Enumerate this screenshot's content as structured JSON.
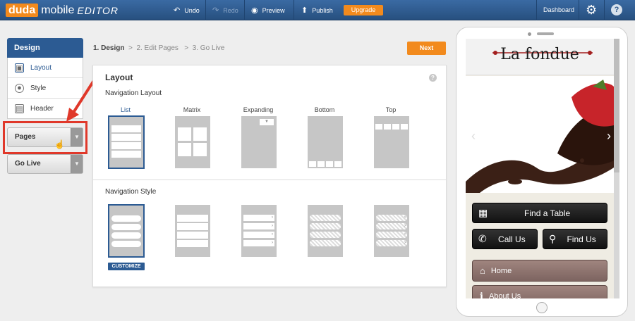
{
  "topbar": {
    "logo_duda": "duda",
    "logo_mobile": "mobile",
    "logo_editor": "EDITOR",
    "undo": "Undo",
    "redo": "Redo",
    "preview": "Preview",
    "publish": "Publish",
    "upgrade": "Upgrade",
    "dashboard": "Dashboard",
    "help": "?"
  },
  "sidebar": {
    "design": "Design",
    "items": [
      {
        "label": "Layout",
        "icon": "layout-icon",
        "active": true
      },
      {
        "label": "Style",
        "icon": "palette-icon",
        "active": false
      },
      {
        "label": "Header",
        "icon": "header-icon",
        "active": false
      }
    ],
    "pages": "Pages",
    "go_live": "Go Live"
  },
  "breadcrumb": {
    "step1": "1. Design",
    "sep": ">",
    "step2": "2. Edit Pages",
    "step3": "3. Go Live"
  },
  "next": "Next",
  "panel": {
    "title": "Layout",
    "help": "?",
    "nav_layout_title": "Navigation Layout",
    "nav_layouts": [
      "List",
      "Matrix",
      "Expanding",
      "Bottom",
      "Top"
    ],
    "selected_layout": "List",
    "nav_style_title": "Navigation Style",
    "customize": "CUSTOMIZE"
  },
  "preview": {
    "brand": "La fondue",
    "buttons": {
      "find_table": "Find a Table",
      "call_us": "Call Us",
      "find_us": "Find Us"
    },
    "menu": [
      "Home",
      "About Us"
    ]
  },
  "colors": {
    "topbar": "#2f5a8c",
    "accent": "#f28a1d",
    "selected": "#2c5b93",
    "highlight": "#e0382a"
  }
}
